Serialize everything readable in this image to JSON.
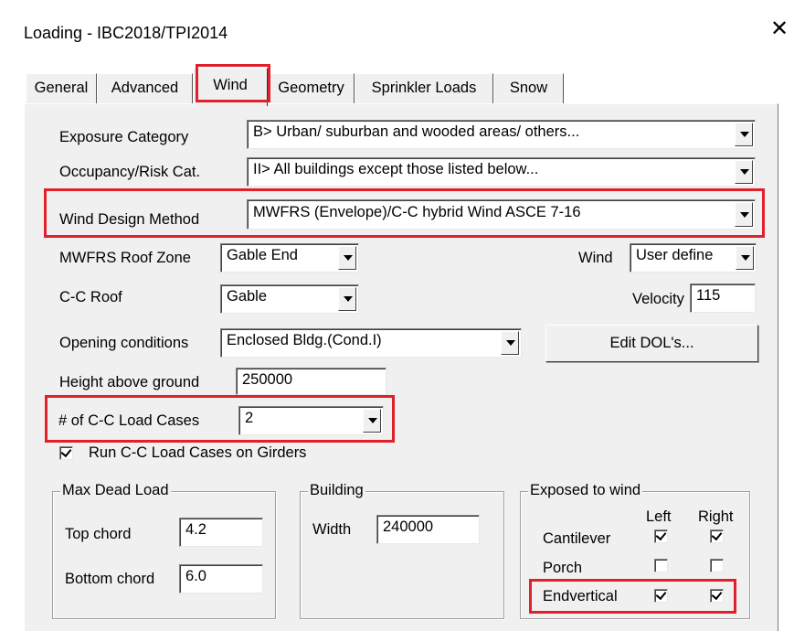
{
  "window": {
    "title": "Loading - IBC2018/TPI2014",
    "close": "✕"
  },
  "tabs": [
    {
      "label": "General"
    },
    {
      "label": "Advanced"
    },
    {
      "label": "Wind"
    },
    {
      "label": "Geometry"
    },
    {
      "label": "Sprinkler Loads"
    },
    {
      "label": "Snow"
    }
  ],
  "fields": {
    "exposure_category": {
      "label": "Exposure Category",
      "value": "B> Urban/ suburban and wooded areas/ others..."
    },
    "occupancy": {
      "label": "Occupancy/Risk Cat.",
      "value": "II> All buildings except those listed below..."
    },
    "wind_design_method": {
      "label": "Wind Design Method",
      "value": "MWFRS (Envelope)/C-C hybrid Wind ASCE 7-16"
    },
    "mwfrs_roof_zone": {
      "label": "MWFRS Roof Zone",
      "value": "Gable End"
    },
    "wind": {
      "label": "Wind",
      "value": "User define"
    },
    "cc_roof": {
      "label": "C-C Roof",
      "value": "Gable"
    },
    "velocity": {
      "label": "Velocity",
      "value": "115"
    },
    "opening_conditions": {
      "label": "Opening conditions",
      "value": "Enclosed Bldg.(Cond.I)"
    },
    "edit_dols": {
      "label": "Edit DOL's..."
    },
    "height_above_ground": {
      "label": "Height above ground",
      "value": "250000"
    },
    "cc_load_cases": {
      "label": "# of C-C Load Cases",
      "value": "2"
    },
    "run_cc_girders": {
      "label": "Run C-C Load Cases on Girders",
      "checked": true
    }
  },
  "max_dead_load": {
    "title": "Max Dead Load",
    "top_chord": {
      "label": "Top chord",
      "value": "4.2"
    },
    "bottom_chord": {
      "label": "Bottom chord",
      "value": "6.0"
    }
  },
  "building": {
    "title": "Building",
    "width": {
      "label": "Width",
      "value": "240000"
    }
  },
  "exposed": {
    "title": "Exposed to wind",
    "col_left": "Left",
    "col_right": "Right",
    "rows": [
      {
        "label": "Cantilever",
        "left": true,
        "right": true
      },
      {
        "label": "Porch",
        "left": false,
        "right": false
      },
      {
        "label": "Endvertical",
        "left": true,
        "right": true
      }
    ]
  },
  "colors": {
    "highlight": "#e0202a",
    "dialog_bg": "#f0f0f0"
  }
}
